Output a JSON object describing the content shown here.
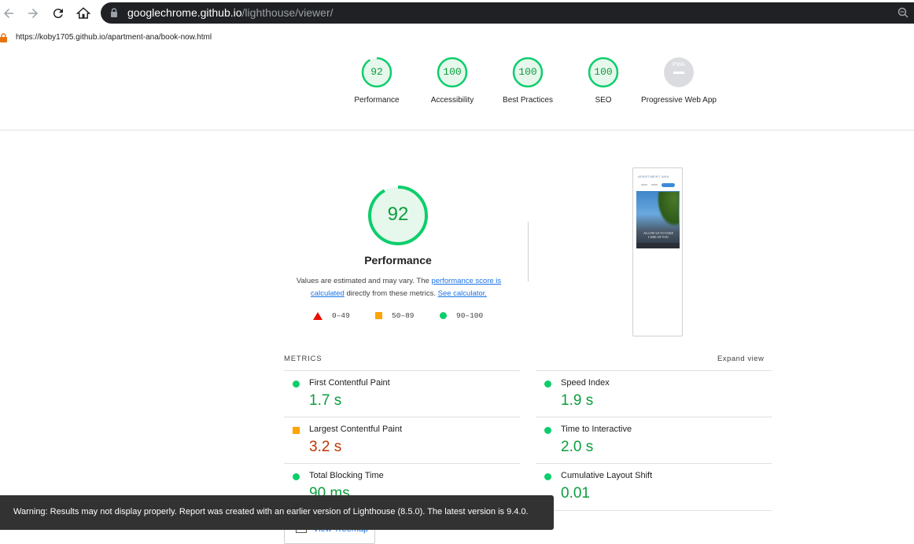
{
  "browser": {
    "url_host": "googlechrome.github.io",
    "url_path": "/lighthouse/viewer/",
    "report_url": "https://koby1705.github.io/apartment-ana/book-now.html"
  },
  "gauges": [
    {
      "score": "92",
      "label": "Performance"
    },
    {
      "score": "100",
      "label": "Accessibility"
    },
    {
      "score": "100",
      "label": "Best Practices"
    },
    {
      "score": "100",
      "label": "SEO"
    },
    {
      "score": "PWA",
      "label": "Progressive Web App"
    }
  ],
  "performance": {
    "score": "92",
    "title": "Performance",
    "desc_prefix": "Values are estimated and may vary. The ",
    "desc_link1": "performance score is calculated",
    "desc_mid": " directly from these metrics. ",
    "desc_link2": "See calculator."
  },
  "legend": {
    "fail": "0–49",
    "average": "50–89",
    "pass": "90–100"
  },
  "screenshot": {
    "brand": "APARTMENT ANA",
    "hero_text": "ALLOW US TO TAKE CARE OF YOU"
  },
  "metrics": {
    "heading": "METRICS",
    "expand": "Expand view",
    "items": [
      {
        "name": "First Contentful Paint",
        "value": "1.7 s",
        "rating": "pass"
      },
      {
        "name": "Speed Index",
        "value": "1.9 s",
        "rating": "pass"
      },
      {
        "name": "Largest Contentful Paint",
        "value": "3.2 s",
        "rating": "average"
      },
      {
        "name": "Time to Interactive",
        "value": "2.0 s",
        "rating": "pass"
      },
      {
        "name": "Total Blocking Time",
        "value": "90 ms",
        "rating": "pass"
      },
      {
        "name": "Cumulative Layout Shift",
        "value": "0.01",
        "rating": "pass"
      }
    ]
  },
  "treemap_label": "View Treemap",
  "toast": "Warning: Results may not display properly. Report was created with an earlier version of Lighthouse (8.5.0). The latest version is 9.4.0."
}
